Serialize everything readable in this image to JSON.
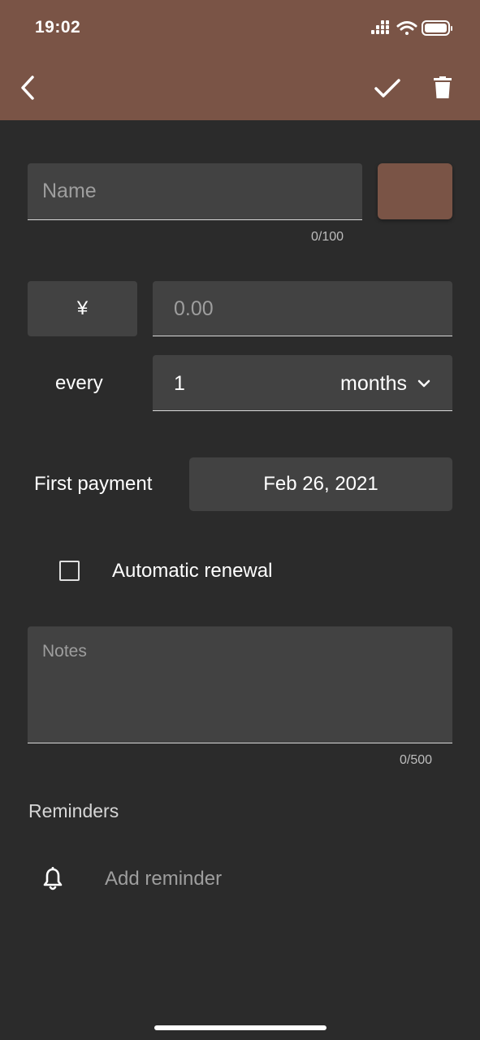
{
  "status_bar": {
    "time": "19:02"
  },
  "header": {
    "background_color": "#7a5446",
    "back_icon": "chevron-left-icon",
    "save_icon": "check-icon",
    "delete_icon": "trash-icon"
  },
  "form": {
    "name": {
      "placeholder": "Name",
      "value": "",
      "counter": "0/100"
    },
    "color_swatch": "#7a5446",
    "currency": {
      "symbol": "¥"
    },
    "amount": {
      "placeholder": "0.00",
      "value": ""
    },
    "interval": {
      "every_label": "every",
      "count": "1",
      "unit": "months"
    },
    "first_payment": {
      "label": "First payment",
      "date": "Feb 26, 2021"
    },
    "automatic_renewal": {
      "label": "Automatic renewal",
      "checked": false
    },
    "notes": {
      "placeholder": "Notes",
      "value": "",
      "counter": "0/500"
    },
    "reminders": {
      "section_title": "Reminders",
      "add_label": "Add reminder"
    }
  }
}
